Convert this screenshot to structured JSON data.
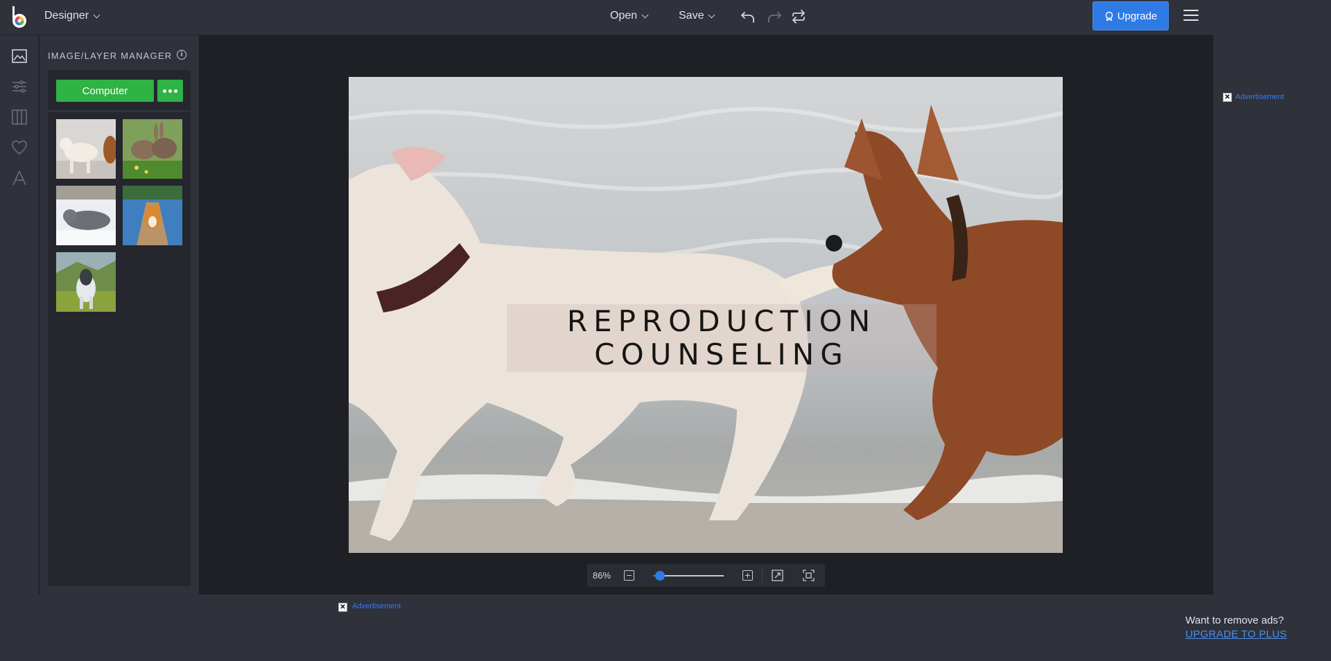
{
  "app": {
    "logo": "befunky-logo-icon",
    "mode_label": "Designer"
  },
  "toolbar": {
    "open_label": "Open",
    "save_label": "Save",
    "undo_icon": "undo-icon",
    "redo_icon": "redo-icon",
    "repeat_icon": "repeat-icon",
    "upgrade_label": "Upgrade",
    "menu_icon": "hamburger-icon"
  },
  "rail": {
    "items": [
      "image-manager-icon",
      "adjust-sliders-icon",
      "layout-panels-icon",
      "heart-icon",
      "text-icon"
    ]
  },
  "panel": {
    "title": "IMAGE/LAYER MANAGER",
    "info_icon": "i",
    "computer_label": "Computer",
    "more_icon": "more-dots-icon",
    "thumbnails": [
      "dog-and-deer",
      "rabbits-on-grass",
      "cat-on-bed",
      "corgi-on-boardwalk",
      "pony-in-field"
    ]
  },
  "canvas": {
    "text_line_1": "REPRODUCTION",
    "text_line_2": "COUNSELING"
  },
  "zoom": {
    "value_label": "86%",
    "level_percent": 86
  },
  "ads": {
    "right_label": "Advertisement",
    "bottom_label": "Advertisement",
    "close_glyph": "✕",
    "remove_text": "Want to remove ads?",
    "upgrade_link": "UPGRADE TO PLUS"
  },
  "colors": {
    "accent_blue": "#2f7be6",
    "accent_green": "#2fb344",
    "chrome": "#2f313b",
    "canvas_bg": "#1f2026"
  }
}
